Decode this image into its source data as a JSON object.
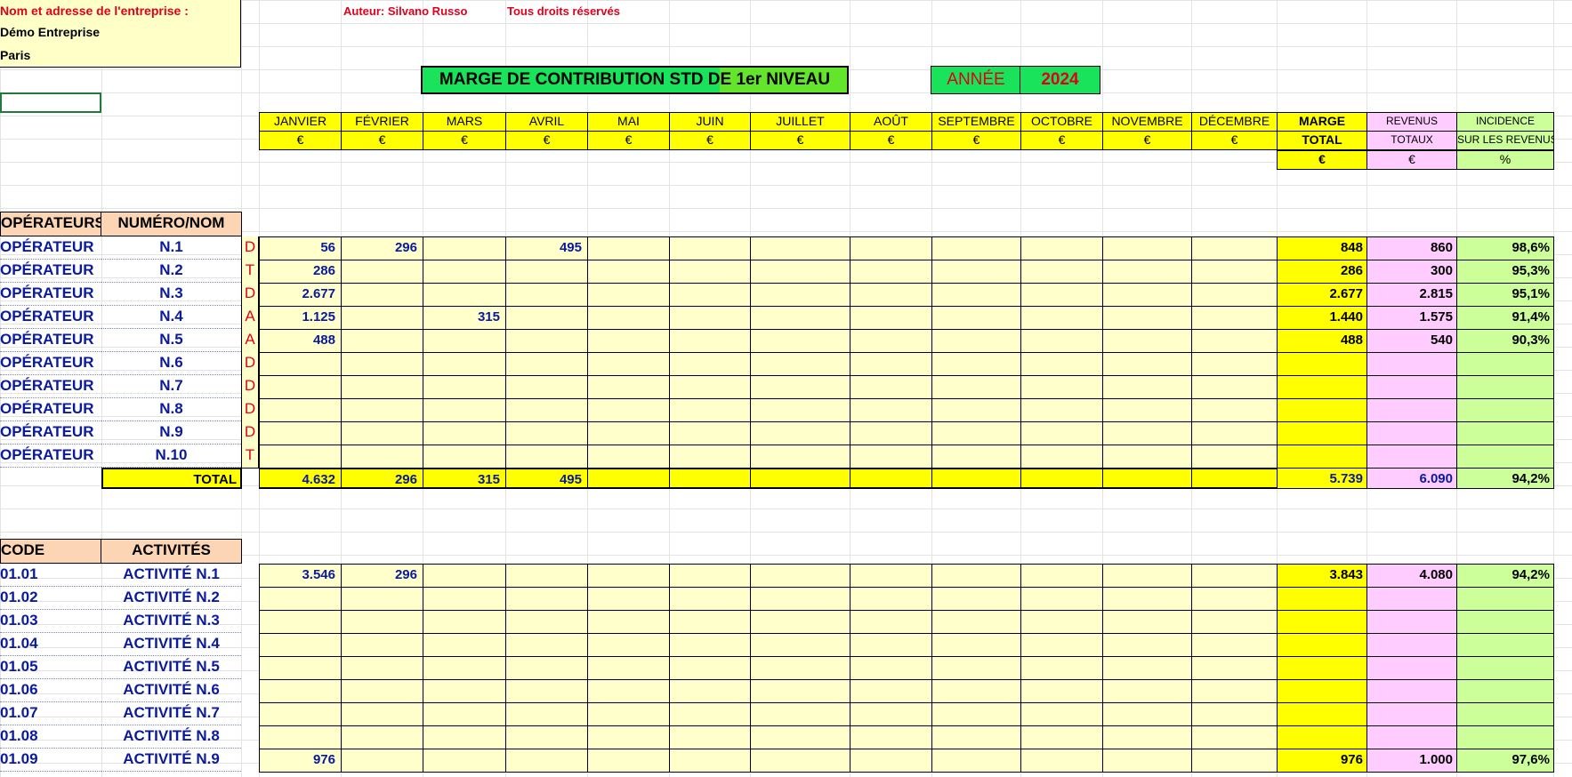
{
  "company": {
    "label": "Nom et adresse de l'entreprise :",
    "name": "Démo Entreprise",
    "city": "Paris"
  },
  "author": "Auteur: Silvano Russo",
  "rights": "Tous droits réservés",
  "title": "MARGE DE CONTRIBUTION STD DE 1er NIVEAU",
  "year_label": "ANNÉE",
  "year": "2024",
  "months": [
    "JANVIER",
    "FÉVRIER",
    "MARS",
    "AVRIL",
    "MAI",
    "JUIN",
    "JUILLET",
    "AOÛT",
    "SEPTEMBRE",
    "OCTOBRE",
    "NOVEMBRE",
    "DÉCEMBRE"
  ],
  "currency": "€",
  "percent": "%",
  "summary_headers": {
    "marge_1": "MARGE",
    "marge_2": "TOTAL",
    "revenus_1": "REVENUS",
    "revenus_2": "TOTAUX",
    "incidence_1": "INCIDENCE",
    "incidence_2": "SUR LES REVENUS"
  },
  "operators": {
    "header_1": "OPÉRATEURS",
    "header_2": "NUMÉRO/NOM",
    "rows": [
      {
        "label": "OPÉRATEUR",
        "num": "N.1",
        "flag": "D",
        "values": [
          "56",
          "296",
          "",
          "495",
          "",
          "",
          "",
          "",
          "",
          "",
          "",
          ""
        ],
        "marge": "848",
        "revenus": "860",
        "incidence": "98,6%"
      },
      {
        "label": "OPÉRATEUR",
        "num": "N.2",
        "flag": "T",
        "values": [
          "286",
          "",
          "",
          "",
          "",
          "",
          "",
          "",
          "",
          "",
          "",
          ""
        ],
        "marge": "286",
        "revenus": "300",
        "incidence": "95,3%"
      },
      {
        "label": "OPÉRATEUR",
        "num": "N.3",
        "flag": "D",
        "values": [
          "2.677",
          "",
          "",
          "",
          "",
          "",
          "",
          "",
          "",
          "",
          "",
          ""
        ],
        "marge": "2.677",
        "revenus": "2.815",
        "incidence": "95,1%"
      },
      {
        "label": "OPÉRATEUR",
        "num": "N.4",
        "flag": "A",
        "values": [
          "1.125",
          "",
          "315",
          "",
          "",
          "",
          "",
          "",
          "",
          "",
          "",
          ""
        ],
        "marge": "1.440",
        "revenus": "1.575",
        "incidence": "91,4%"
      },
      {
        "label": "OPÉRATEUR",
        "num": "N.5",
        "flag": "A",
        "values": [
          "488",
          "",
          "",
          "",
          "",
          "",
          "",
          "",
          "",
          "",
          "",
          ""
        ],
        "marge": "488",
        "revenus": "540",
        "incidence": "90,3%"
      },
      {
        "label": "OPÉRATEUR",
        "num": "N.6",
        "flag": "D",
        "values": [
          "",
          "",
          "",
          "",
          "",
          "",
          "",
          "",
          "",
          "",
          "",
          ""
        ],
        "marge": "",
        "revenus": "",
        "incidence": ""
      },
      {
        "label": "OPÉRATEUR",
        "num": "N.7",
        "flag": "D",
        "values": [
          "",
          "",
          "",
          "",
          "",
          "",
          "",
          "",
          "",
          "",
          "",
          ""
        ],
        "marge": "",
        "revenus": "",
        "incidence": ""
      },
      {
        "label": "OPÉRATEUR",
        "num": "N.8",
        "flag": "D",
        "values": [
          "",
          "",
          "",
          "",
          "",
          "",
          "",
          "",
          "",
          "",
          "",
          ""
        ],
        "marge": "",
        "revenus": "",
        "incidence": ""
      },
      {
        "label": "OPÉRATEUR",
        "num": "N.9",
        "flag": "D",
        "values": [
          "",
          "",
          "",
          "",
          "",
          "",
          "",
          "",
          "",
          "",
          "",
          ""
        ],
        "marge": "",
        "revenus": "",
        "incidence": ""
      },
      {
        "label": "OPÉRATEUR",
        "num": "N.10",
        "flag": "T",
        "values": [
          "",
          "",
          "",
          "",
          "",
          "",
          "",
          "",
          "",
          "",
          "",
          ""
        ],
        "marge": "",
        "revenus": "",
        "incidence": ""
      }
    ],
    "total": {
      "label": "TOTAL",
      "values": [
        "4.632",
        "296",
        "315",
        "495",
        "",
        "",
        "",
        "",
        "",
        "",
        "",
        ""
      ],
      "marge": "5.739",
      "revenus": "6.090",
      "incidence": "94,2%"
    }
  },
  "activities": {
    "header_1": "CODE",
    "header_2": "ACTIVITÉS",
    "rows": [
      {
        "code": "01.01",
        "name": "ACTIVITÉ N.1",
        "values": [
          "3.546",
          "296",
          "",
          "",
          "",
          "",
          "",
          "",
          "",
          "",
          "",
          ""
        ],
        "marge": "3.843",
        "revenus": "4.080",
        "incidence": "94,2%"
      },
      {
        "code": "01.02",
        "name": "ACTIVITÉ N.2",
        "values": [
          "",
          "",
          "",
          "",
          "",
          "",
          "",
          "",
          "",
          "",
          "",
          ""
        ],
        "marge": "",
        "revenus": "",
        "incidence": ""
      },
      {
        "code": "01.03",
        "name": "ACTIVITÉ N.3",
        "values": [
          "",
          "",
          "",
          "",
          "",
          "",
          "",
          "",
          "",
          "",
          "",
          ""
        ],
        "marge": "",
        "revenus": "",
        "incidence": ""
      },
      {
        "code": "01.04",
        "name": "ACTIVITÉ N.4",
        "values": [
          "",
          "",
          "",
          "",
          "",
          "",
          "",
          "",
          "",
          "",
          "",
          ""
        ],
        "marge": "",
        "revenus": "",
        "incidence": ""
      },
      {
        "code": "01.05",
        "name": "ACTIVITÉ N.5",
        "values": [
          "",
          "",
          "",
          "",
          "",
          "",
          "",
          "",
          "",
          "",
          "",
          ""
        ],
        "marge": "",
        "revenus": "",
        "incidence": ""
      },
      {
        "code": "01.06",
        "name": "ACTIVITÉ N.6",
        "values": [
          "",
          "",
          "",
          "",
          "",
          "",
          "",
          "",
          "",
          "",
          "",
          ""
        ],
        "marge": "",
        "revenus": "",
        "incidence": ""
      },
      {
        "code": "01.07",
        "name": "ACTIVITÉ N.7",
        "values": [
          "",
          "",
          "",
          "",
          "",
          "",
          "",
          "",
          "",
          "",
          "",
          ""
        ],
        "marge": "",
        "revenus": "",
        "incidence": ""
      },
      {
        "code": "01.08",
        "name": "ACTIVITÉ N.8",
        "values": [
          "",
          "",
          "",
          "",
          "",
          "",
          "",
          "",
          "",
          "",
          "",
          ""
        ],
        "marge": "",
        "revenus": "",
        "incidence": ""
      },
      {
        "code": "01.09",
        "name": "ACTIVITÉ N.9",
        "values": [
          "976",
          "",
          "",
          "",
          "",
          "",
          "",
          "",
          "",
          "",
          "",
          ""
        ],
        "marge": "976",
        "revenus": "1.000",
        "incidence": "97,6%"
      }
    ]
  }
}
